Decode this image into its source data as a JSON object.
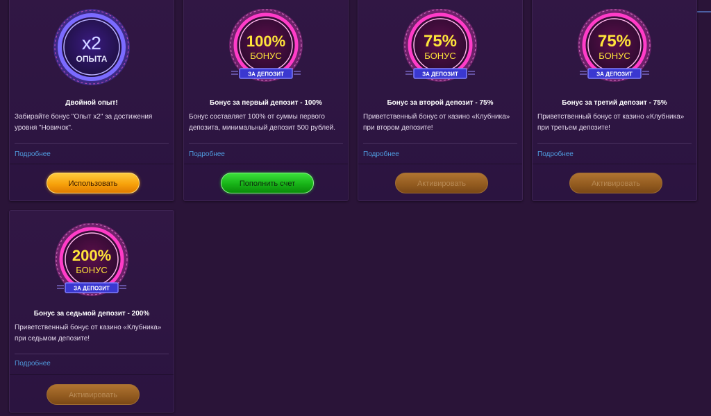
{
  "cards": [
    {
      "badge": {
        "big": "x2",
        "small": "ОПЫТА",
        "ribbon": "",
        "ring_color": "#6a6cff",
        "text_color": "#e8e8ff"
      },
      "title": "Двойной опыт!",
      "desc_line1": "Забирайте бонус \"Опыт x2\" за достижения",
      "desc_line2": "уровня \"Новичок\".",
      "link": "Подробнее",
      "button": "Использовать"
    },
    {
      "badge": {
        "big": "100%",
        "small": "БОНУС",
        "ribbon": "ЗА ДЕПОЗИТ",
        "ring_color": "#ff3cc8",
        "text_color": "#ffe43a"
      },
      "title": "Бонус за первый депозит - 100%",
      "desc_line1": "Бонус составляет 100% от суммы первого",
      "desc_line2": "депозита, минимальный депозит 500 рублей.",
      "link": "Подробнее",
      "button": "Пополнить счет"
    },
    {
      "badge": {
        "big": "75%",
        "small": "БОНУС",
        "ribbon": "ЗА ДЕПОЗИТ",
        "ring_color": "#ff3cc8",
        "text_color": "#ffe43a"
      },
      "title": "Бонус за второй депозит - 75%",
      "desc_line1": "Приветственный бонус от казино «Клубника»",
      "desc_line2": "при втором депозите!",
      "link": "Подробнее",
      "button": "Активировать"
    },
    {
      "badge": {
        "big": "75%",
        "small": "БОНУС",
        "ribbon": "ЗА ДЕПОЗИТ",
        "ring_color": "#ff3cc8",
        "text_color": "#ffe43a"
      },
      "title": "Бонус за третий депозит - 75%",
      "desc_line1": "Приветственный бонус от казино «Клубника»",
      "desc_line2": "при третьем депозите!",
      "link": "Подробнее",
      "button": "Активировать"
    },
    {
      "badge": {
        "big": "200%",
        "small": "БОНУС",
        "ribbon": "ЗА ДЕПОЗИТ",
        "ring_color": "#ff3cc8",
        "text_color": "#ffe43a"
      },
      "title": "Бонус за седьмой депозит - 200%",
      "desc_line1": "Приветственный бонус от казино «Клубника»",
      "desc_line2": "при седьмом депозите!",
      "link": "Подробнее",
      "button": "Активировать"
    }
  ],
  "colors": {
    "background": "#2a1438",
    "card": "#311744",
    "link": "#4f9bde",
    "button_active_orange": "#f7a20b",
    "button_active_green": "#17b317",
    "button_inactive": "#915a1f"
  }
}
